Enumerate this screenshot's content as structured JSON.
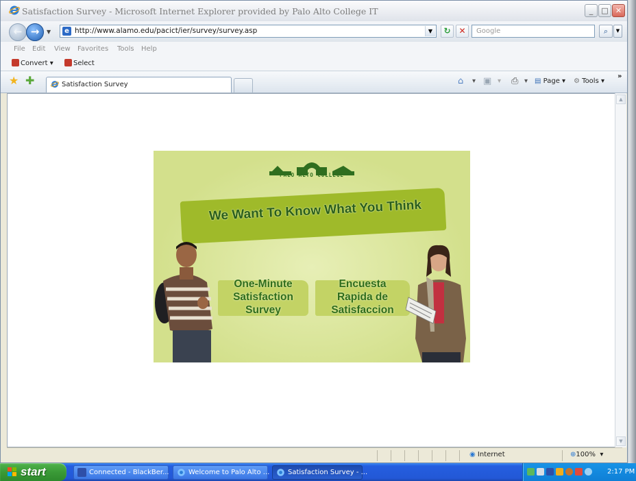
{
  "window": {
    "title": "Satisfaction Survey - Microsoft Internet Explorer provided by Palo Alto College IT"
  },
  "navbar": {
    "url": "http://www.alamo.edu/pacict/ier/survey/survey.asp",
    "search_placeholder": "Google"
  },
  "menubar": {
    "items": [
      "File",
      "Edit",
      "View",
      "Favorites",
      "Tools",
      "Help"
    ]
  },
  "toolbar2": {
    "convert": "Convert",
    "select": "Select"
  },
  "tabs": {
    "active_label": "Satisfaction Survey"
  },
  "commandbar": {
    "page": "Page",
    "tools": "Tools"
  },
  "banner": {
    "logo_text": "PALO ALTO COLLEGE",
    "headline": "We Want To Know What You Think",
    "button_en": [
      "One-Minute",
      "Satisfaction",
      "Survey"
    ],
    "button_es": [
      "Encuesta",
      "Rapida de",
      "Satisfaccion"
    ]
  },
  "status": {
    "zone": "Internet",
    "zoom": "100%"
  },
  "taskbar": {
    "start": "start",
    "items": [
      "Connected - BlackBer...",
      "Welcome to Palo Alto ...",
      "Satisfaction Survey - ..."
    ],
    "clock": "2:17 PM"
  },
  "colors": {
    "banner_green": "#9fba2a",
    "text_green": "#2f6d1a",
    "taskbar_blue": "#245ee0",
    "start_green": "#3a9a37"
  }
}
